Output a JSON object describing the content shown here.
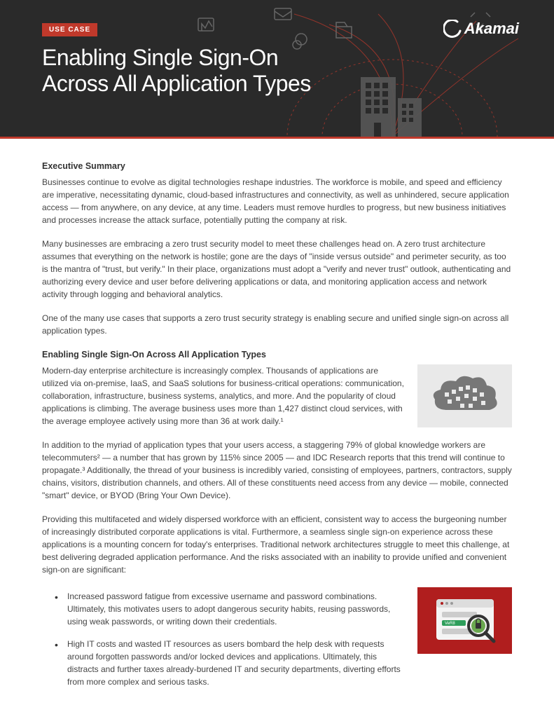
{
  "badge": "USE CASE",
  "title_line1": "Enabling Single Sign-On",
  "title_line2": "Across All Application Types",
  "brand": "Akamai",
  "sections": {
    "exec_head": "Executive Summary",
    "exec_p1": "Businesses continue to evolve as digital technologies reshape industries. The workforce is mobile, and speed and efficiency are imperative, necessitating dynamic, cloud-based infrastructures and connectivity, as well as unhindered, secure application access — from anywhere, on any device, at any time. Leaders must remove hurdles to progress, but new business initiatives and processes increase the attack surface, potentially putting the company at risk.",
    "exec_p2": "Many businesses are embracing a zero trust security model to meet these challenges head on. A zero trust architecture assumes that everything on the network is hostile; gone are the days of \"inside versus outside\" and perimeter security, as too is the mantra of \"trust, but verify.\" In their place, organizations must adopt a \"verify and never trust\" outlook, authenticating and authorizing every device and user before delivering applications or data, and monitoring application access and network activity through logging and behavioral analytics.",
    "exec_p3": "One of the many use cases that supports a zero trust security strategy is enabling secure and unified single sign-on across all application types.",
    "sso_head": "Enabling Single Sign-On Across All Application Types",
    "sso_p1": "Modern-day enterprise architecture is increasingly complex. Thousands of applications are utilized via on-premise, IaaS, and SaaS solutions for business-critical operations: communication, collaboration, infrastructure, business systems, analytics, and more. And the popularity of cloud applications is climbing. The average business uses more than 1,427 distinct cloud services, with the average employee actively using more than 36 at work daily.¹",
    "sso_p2": "In addition to the myriad of application types that your users access, a staggering 79% of global knowledge workers are telecommuters² — a number that has grown by 115% since 2005 — and IDC Research reports that this trend will continue to propagate.³ Additionally, the thread of your business is incredibly varied, consisting of employees, partners, contractors, supply chains, visitors, distribution channels, and others. All of these constituents need access from any device — mobile, connected \"smart\" device, or BYOD (Bring Your Own Device).",
    "sso_p3": "Providing this multifaceted and widely dispersed workforce with an efficient, consistent way to access the burgeoning number of increasingly distributed corporate applications is vital. Furthermore, a seamless single sign-on experience across these applications is a mounting concern for today's enterprises. Traditional network architectures struggle to meet this challenge, at best delivering degraded application performance. And the risks associated with an inability to provide unified and convenient sign-on are significant:",
    "bullet1": "Increased password fatigue from excessive username and password combinations. Ultimately, this motivates users to adopt dangerous security habits, reusing passwords, using weak passwords, or writing down their credentials.",
    "bullet2": "High IT costs and wasted IT resources as users bombard the help desk with requests around forgotten passwords and/or locked devices and applications. Ultimately, this distracts and further taxes already-burdened IT and security departments, diverting efforts from more complex and serious tasks."
  },
  "illustrations": {
    "cloud_label": "cloud-of-app-icons",
    "password_label": "password-security-browser"
  }
}
